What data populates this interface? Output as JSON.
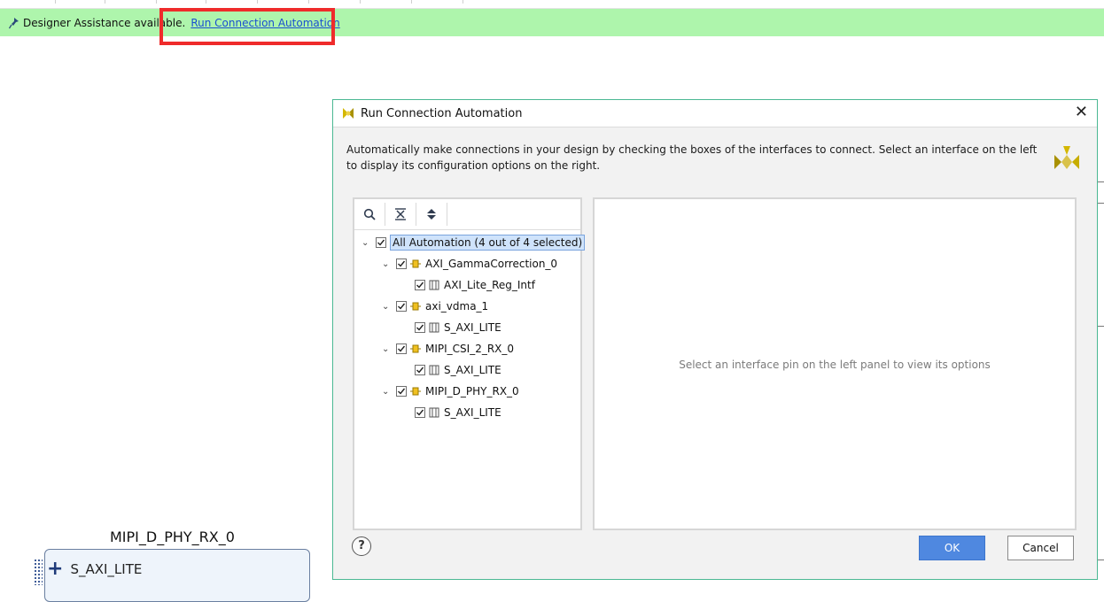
{
  "assist_bar": {
    "text": "Designer Assistance available.",
    "link": "Run Connection Automation"
  },
  "canvas": {
    "block_title": "MIPI_D_PHY_RX_0",
    "block_port": "S_AXI_LITE"
  },
  "dialog": {
    "title": "Run Connection Automation",
    "description": "Automatically make connections in your design by checking the boxes of the interfaces to connect. Select an interface on the left to display its configuration options on the right.",
    "tree": [
      {
        "label": "All Automation (4 out of 4 selected)",
        "checked": true,
        "selected": true
      },
      {
        "label": "AXI_GammaCorrection_0",
        "checked": true
      },
      {
        "label": "AXI_Lite_Reg_Intf",
        "checked": true
      },
      {
        "label": "axi_vdma_1",
        "checked": true
      },
      {
        "label": "S_AXI_LITE",
        "checked": true
      },
      {
        "label": "MIPI_CSI_2_RX_0",
        "checked": true
      },
      {
        "label": "S_AXI_LITE",
        "checked": true
      },
      {
        "label": "MIPI_D_PHY_RX_0",
        "checked": true
      },
      {
        "label": "S_AXI_LITE",
        "checked": true
      }
    ],
    "right_hint": "Select an interface pin on the left panel to view its options",
    "help_label": "?",
    "ok_label": "OK",
    "cancel_label": "Cancel"
  },
  "colors": {
    "assist_bg": "#aef5ac",
    "highlight": "#ef2b2b",
    "dialog_border": "#4bb893",
    "ok_bg": "#4f88e0",
    "link": "#1a4fd0"
  },
  "icons": [
    "pin-icon",
    "vivado-logo-icon",
    "close-icon",
    "search-icon",
    "collapse-all-icon",
    "expand-all-icon",
    "chevron-down-icon",
    "checkbox-icon",
    "ip-block-icon",
    "interface-icon",
    "help-icon",
    "plus-icon"
  ]
}
